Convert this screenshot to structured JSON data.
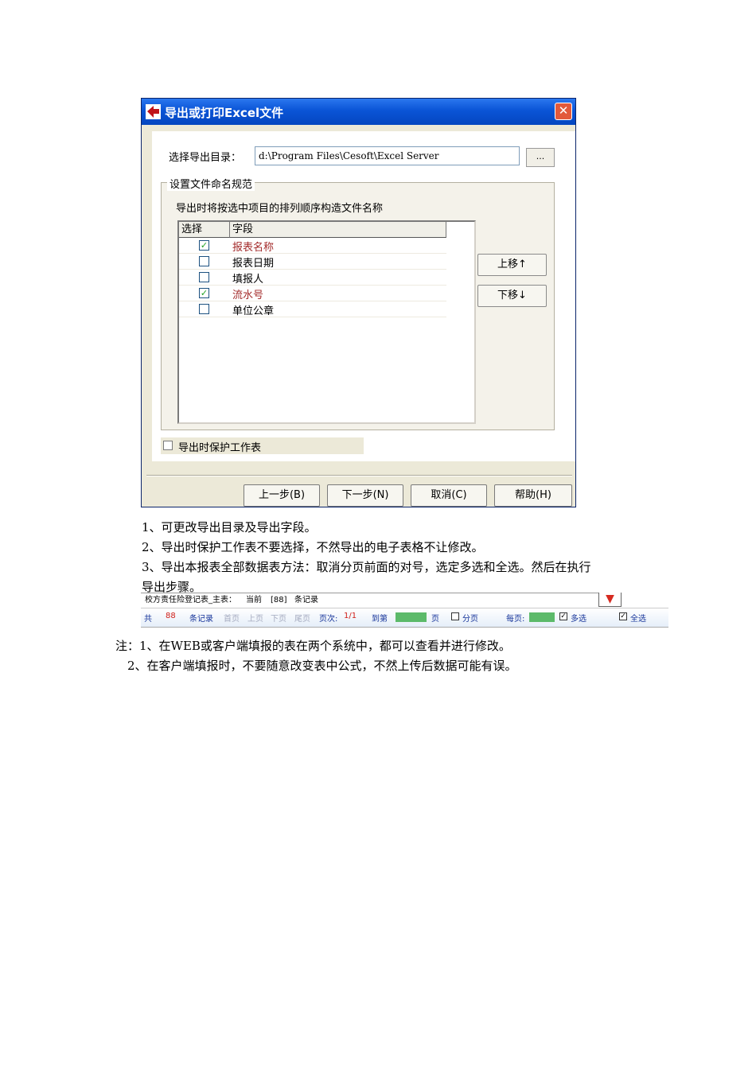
{
  "dialog": {
    "title": "导出或打印Excel文件",
    "close_glyph": "✕",
    "dir_label": "选择导出目录：",
    "dir_value": "d:\\Program Files\\Cesoft\\Excel Server",
    "browse_label": "...",
    "naming_group": "设置文件命名规范",
    "naming_hint": "导出时将按选中项目的排列顺序构造文件名称",
    "columns": {
      "select": "选择",
      "field": "字段"
    },
    "fields": [
      {
        "label": "报表名称",
        "checked": true
      },
      {
        "label": "报表日期",
        "checked": false
      },
      {
        "label": "填报人",
        "checked": false
      },
      {
        "label": "流水号",
        "checked": true
      },
      {
        "label": "单位公章",
        "checked": false
      }
    ],
    "check_glyph": "✓",
    "move_up": "上移↑",
    "move_down": "下移↓",
    "protect_label": "导出时保护工作表",
    "buttons": {
      "prev": "上一步(B)",
      "next": "下一步(N)",
      "cancel": "取消(C)",
      "help": "帮助(H)"
    }
  },
  "instructions": [
    "1、可更改导出目录及导出字段。",
    "2、导出时保护工作表不要选择，不然导出的电子表格不让修改。",
    "3、导出本报表全部数据表方法：取消分页前面的对号，选定多选和全选。然后在执行",
    "导出步骤。"
  ],
  "toolbar": {
    "title": "校方责任险登记表_主表：",
    "current_label": "当前",
    "current_value": "[88]",
    "records_label": "条记录",
    "arrow_glyph": "▼",
    "total_label": "共",
    "total_value": "88",
    "records_label2": "条记录",
    "first": "首页",
    "prev": "上页",
    "next": "下页",
    "last": "尾页",
    "page_label": "页次:",
    "page_value": "1/1",
    "goto_label": "到第",
    "page_unit": "页",
    "paging": "分页",
    "per_page": "每页:",
    "multi_select": "多选",
    "select_all": "全选",
    "check_glyph": "✓"
  },
  "notes": [
    "注：1、在WEB或客户端填报的表在两个系统中，都可以查看并进行修改。",
    "2、在客户端填报时，不要随意改变表中公式，不然上传后数据可能有误。"
  ]
}
